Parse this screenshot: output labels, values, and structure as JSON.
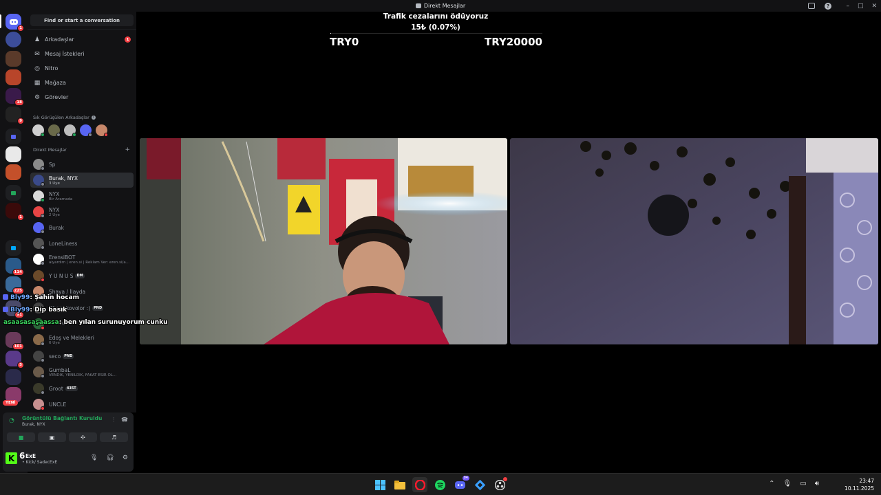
{
  "window": {
    "title": "Direkt Mesajlar"
  },
  "rail": {
    "badges": [
      "1",
      "18",
      "9",
      "1",
      "114",
      "225",
      "91",
      "101",
      "5"
    ],
    "new_label": "YENİ"
  },
  "sidebar": {
    "find_button": "Find or start a conversation",
    "nav": [
      {
        "label": "Arkadaşlar",
        "icon": "friends-icon",
        "badge": "1"
      },
      {
        "label": "Mesaj İstekleri",
        "icon": "mail-icon"
      },
      {
        "label": "Nitro",
        "icon": "nitro-icon"
      },
      {
        "label": "Mağaza",
        "icon": "shop-icon"
      },
      {
        "label": "Görevler",
        "icon": "quests-icon"
      }
    ],
    "frequent_header": "Sık Görüşülen Arkadaşlar",
    "dm_header": "Direkt Mesajlar",
    "dms": [
      {
        "name": "Sp",
        "sub": "",
        "color": "#8a8a8a"
      },
      {
        "name": "Burak, NYX",
        "sub": "3 Üye",
        "color": "#3a4a8a",
        "active": true
      },
      {
        "name": "NYX",
        "sub": "Bir Aramada",
        "color": "#d9d9d9"
      },
      {
        "name": "NYX",
        "sub": "2 Üye",
        "color": "#e84545"
      },
      {
        "name": "Burak",
        "sub": "",
        "color": "#5865f2"
      },
      {
        "name": "LoneLiness",
        "sub": "",
        "color": "#555"
      },
      {
        "name": "ErensiBOT",
        "sub": "aiyardım | eren.si | Reklam Ver: eren.si/a...",
        "color": "#ffffff"
      },
      {
        "name": "Y U N U S",
        "sub": "",
        "color": "#6b4a2a",
        "tag": "DM"
      },
      {
        "name": "Şhaya / İlayda",
        "sub": "",
        "color": "#c7876a"
      },
      {
        "name": "Ghom kovolor :)",
        "sub": "",
        "color": "#444",
        "tag": "PND"
      },
      {
        "name": "",
        "sub": "#freeyighurs",
        "color": "#2a6a3a"
      },
      {
        "name": "Edoş ve Melekleri",
        "sub": "6 Üye",
        "color": "#8a6a4a"
      },
      {
        "name": "seco",
        "sub": "",
        "color": "#444",
        "tag": "PND"
      },
      {
        "name": "GumbaL",
        "sub": "VENDIK, YENILDIK, FAKAT ESIR OL...",
        "color": "#6a5a4a"
      },
      {
        "name": "Groot",
        "sub": "",
        "color": "#3a3a2a",
        "tag": "435T"
      },
      {
        "name": "UNCLE",
        "sub": "",
        "color": "#c79090"
      }
    ]
  },
  "overlay_chat": [
    {
      "user": "Bly99",
      "message": ": Şahin hocam"
    },
    {
      "user": "Bly99",
      "message": ": Dip basık"
    },
    {
      "user": "asaasasaşaassa",
      "message": ": ben yılan surunuyorum cunku"
    }
  ],
  "voice": {
    "status": "Görüntülü Bağlantı Kuruldu",
    "channel": "Burak, NYX"
  },
  "user": {
    "number": "6",
    "name": "ExE",
    "status": "• Kick/ SadecExE"
  },
  "donation": {
    "title": "Trafik cezalarını ödüyoruz",
    "amount": "15₺ (0.07%)",
    "progress_percent": 0.07,
    "min": "TRY0",
    "max": "TRY20000"
  },
  "taskbar": {
    "discord_badge": "94",
    "time": "23:47",
    "date": "10.11.2025"
  }
}
